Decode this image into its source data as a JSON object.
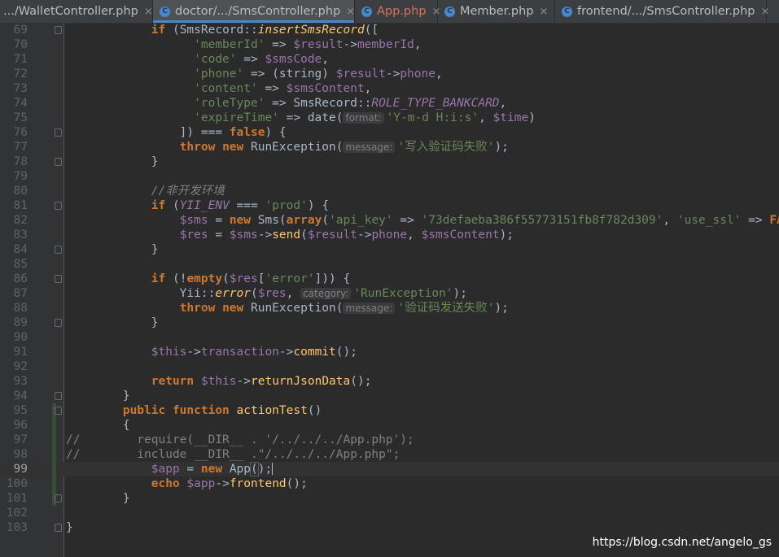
{
  "tabs": [
    {
      "label": ".../WalletController.php",
      "icon": "php-file-icon",
      "icon_glyph": "",
      "closable": true,
      "modified": false
    },
    {
      "label": "doctor/.../SmsController.php",
      "icon": "php-class-file-icon",
      "icon_glyph": "C",
      "closable": true,
      "modified": false
    },
    {
      "label": "App.php",
      "icon": "php-class-file-icon",
      "icon_glyph": "C",
      "closable": true,
      "modified": true
    },
    {
      "label": "Member.php",
      "icon": "php-class-file-icon",
      "icon_glyph": "C",
      "closable": true,
      "modified": false
    },
    {
      "label": "frontend/.../SmsController.php",
      "icon": "php-class-file-icon",
      "icon_glyph": "C",
      "closable": true,
      "modified": false
    }
  ],
  "active_tab": 1,
  "current_line": 99,
  "colors": {
    "keyword": "#cc7832",
    "variable": "#9876aa",
    "string": "#6a8759",
    "function": "#ffc66d",
    "comment": "#808080",
    "text": "#a9b7c6",
    "modified_tab": "#e06c5b"
  },
  "lines": [
    {
      "num": "69",
      "fold": true,
      "tokens": [
        [
          "p",
          "            "
        ],
        [
          "kw",
          "if"
        ],
        [
          "p",
          " (SmsRecord::"
        ],
        [
          "sfn",
          "insertSmsRecord"
        ],
        [
          "p",
          "(["
        ]
      ]
    },
    {
      "num": "70",
      "tokens": [
        [
          "p",
          "                  "
        ],
        [
          "str",
          "'memberId'"
        ],
        [
          "p",
          " => "
        ],
        [
          "var",
          "$result"
        ],
        [
          "p",
          "->"
        ],
        [
          "var",
          "memberId"
        ],
        [
          "p",
          ","
        ]
      ]
    },
    {
      "num": "71",
      "tokens": [
        [
          "p",
          "                  "
        ],
        [
          "str",
          "'code'"
        ],
        [
          "p",
          " => "
        ],
        [
          "var",
          "$smsCode"
        ],
        [
          "p",
          ","
        ]
      ]
    },
    {
      "num": "72",
      "tokens": [
        [
          "p",
          "                  "
        ],
        [
          "str",
          "'phone'"
        ],
        [
          "p",
          " => (string) "
        ],
        [
          "var",
          "$result"
        ],
        [
          "p",
          "->"
        ],
        [
          "var",
          "phone"
        ],
        [
          "p",
          ","
        ]
      ]
    },
    {
      "num": "73",
      "tokens": [
        [
          "p",
          "                  "
        ],
        [
          "str",
          "'content'"
        ],
        [
          "p",
          " => "
        ],
        [
          "var",
          "$smsContent"
        ],
        [
          "p",
          ","
        ]
      ]
    },
    {
      "num": "74",
      "tokens": [
        [
          "p",
          "                  "
        ],
        [
          "str",
          "'roleType'"
        ],
        [
          "p",
          " => SmsRecord::"
        ],
        [
          "cst",
          "ROLE_TYPE_BANKCARD"
        ],
        [
          "p",
          ","
        ]
      ]
    },
    {
      "num": "75",
      "tokens": [
        [
          "p",
          "                  "
        ],
        [
          "str",
          "'expireTime'"
        ],
        [
          "p",
          " => date("
        ],
        [
          "hint",
          "format:"
        ],
        [
          "str",
          "'Y-m-d H:i:s'"
        ],
        [
          "p",
          ", "
        ],
        [
          "var",
          "$time"
        ],
        [
          "p",
          ")"
        ]
      ]
    },
    {
      "num": "76",
      "fold": true,
      "tokens": [
        [
          "p",
          "                ]) === "
        ],
        [
          "kw",
          "false"
        ],
        [
          "p",
          ") {"
        ]
      ]
    },
    {
      "num": "77",
      "tokens": [
        [
          "p",
          "                "
        ],
        [
          "kw",
          "throw new"
        ],
        [
          "p",
          " RunException("
        ],
        [
          "hint",
          "message:"
        ],
        [
          "str",
          "'写入验证码失败'"
        ],
        [
          "p",
          ");"
        ]
      ]
    },
    {
      "num": "78",
      "fold": true,
      "tokens": [
        [
          "p",
          "            }"
        ]
      ]
    },
    {
      "num": "79",
      "tokens": []
    },
    {
      "num": "80",
      "tokens": [
        [
          "p",
          "            "
        ],
        [
          "cmti",
          "//非开发环境"
        ]
      ]
    },
    {
      "num": "81",
      "fold": true,
      "tokens": [
        [
          "p",
          "            "
        ],
        [
          "kw",
          "if"
        ],
        [
          "p",
          " ("
        ],
        [
          "cst",
          "YII_ENV"
        ],
        [
          "p",
          " === "
        ],
        [
          "str",
          "'prod'"
        ],
        [
          "p",
          ") {"
        ]
      ]
    },
    {
      "num": "82",
      "tokens": [
        [
          "p",
          "                "
        ],
        [
          "var",
          "$sms"
        ],
        [
          "p",
          " = "
        ],
        [
          "kw",
          "new"
        ],
        [
          "p",
          " Sms("
        ],
        [
          "kw",
          "array"
        ],
        [
          "p",
          "("
        ],
        [
          "str",
          "'api_key'"
        ],
        [
          "p",
          " => "
        ],
        [
          "str",
          "'73defaeba386f55773151fb8f782d309'"
        ],
        [
          "p",
          ", "
        ],
        [
          "str",
          "'use_ssl'"
        ],
        [
          "p",
          " => "
        ],
        [
          "kw",
          "FALSE"
        ]
      ]
    },
    {
      "num": "83",
      "tokens": [
        [
          "p",
          "                "
        ],
        [
          "var",
          "$res"
        ],
        [
          "p",
          " = "
        ],
        [
          "var",
          "$sms"
        ],
        [
          "p",
          "->"
        ],
        [
          "fn",
          "send"
        ],
        [
          "p",
          "("
        ],
        [
          "var",
          "$result"
        ],
        [
          "p",
          "->"
        ],
        [
          "var",
          "phone"
        ],
        [
          "p",
          ", "
        ],
        [
          "var",
          "$smsContent"
        ],
        [
          "p",
          ");"
        ]
      ]
    },
    {
      "num": "84",
      "fold": true,
      "tokens": [
        [
          "p",
          "            }"
        ]
      ]
    },
    {
      "num": "85",
      "tokens": []
    },
    {
      "num": "86",
      "fold": true,
      "tokens": [
        [
          "p",
          "            "
        ],
        [
          "kw",
          "if"
        ],
        [
          "p",
          " (!"
        ],
        [
          "kw",
          "empty"
        ],
        [
          "p",
          "("
        ],
        [
          "var",
          "$res"
        ],
        [
          "p",
          "["
        ],
        [
          "str",
          "'error'"
        ],
        [
          "p",
          "])) {"
        ]
      ]
    },
    {
      "num": "87",
      "tokens": [
        [
          "p",
          "                Yii::"
        ],
        [
          "sfn",
          "error"
        ],
        [
          "p",
          "("
        ],
        [
          "var",
          "$res"
        ],
        [
          "p",
          ", "
        ],
        [
          "hint",
          "category:"
        ],
        [
          "str",
          "'RunException'"
        ],
        [
          "p",
          ");"
        ]
      ]
    },
    {
      "num": "88",
      "tokens": [
        [
          "p",
          "                "
        ],
        [
          "kw",
          "throw new"
        ],
        [
          "p",
          " RunException("
        ],
        [
          "hint",
          "message:"
        ],
        [
          "str",
          "'验证码发送失败'"
        ],
        [
          "p",
          ");"
        ]
      ]
    },
    {
      "num": "89",
      "fold": true,
      "tokens": [
        [
          "p",
          "            }"
        ]
      ]
    },
    {
      "num": "90",
      "tokens": []
    },
    {
      "num": "91",
      "tokens": [
        [
          "p",
          "            "
        ],
        [
          "var",
          "$this"
        ],
        [
          "p",
          "->"
        ],
        [
          "var",
          "transaction"
        ],
        [
          "p",
          "->"
        ],
        [
          "fn",
          "commit"
        ],
        [
          "p",
          "();"
        ]
      ]
    },
    {
      "num": "92",
      "tokens": []
    },
    {
      "num": "93",
      "tokens": [
        [
          "p",
          "            "
        ],
        [
          "kw",
          "return"
        ],
        [
          "p",
          " "
        ],
        [
          "var",
          "$this"
        ],
        [
          "p",
          "->"
        ],
        [
          "fn",
          "returnJsonData"
        ],
        [
          "p",
          "();"
        ]
      ]
    },
    {
      "num": "94",
      "fold": true,
      "tokens": [
        [
          "p",
          "        }"
        ]
      ]
    },
    {
      "num": "95",
      "fold": true,
      "vcs": true,
      "tokens": [
        [
          "p",
          "        "
        ],
        [
          "kw",
          "public function"
        ],
        [
          "p",
          " "
        ],
        [
          "fn",
          "actionTest"
        ],
        [
          "p",
          "()"
        ]
      ]
    },
    {
      "num": "96",
      "vcs": true,
      "tokens": [
        [
          "p",
          "        {"
        ]
      ]
    },
    {
      "num": "97",
      "vcs": true,
      "tokens": [
        [
          "cmt",
          "//        require(__DIR__ . '/../../../App.php');"
        ]
      ]
    },
    {
      "num": "98",
      "vcs": true,
      "tokens": [
        [
          "cmt",
          "//        include __DIR__ .\"/../../../App.php\";"
        ]
      ]
    },
    {
      "num": "99",
      "vcs": true,
      "cur": true,
      "tokens": [
        [
          "p",
          "            "
        ],
        [
          "var",
          "$app"
        ],
        [
          "p",
          " = "
        ],
        [
          "kw",
          "new"
        ],
        [
          "p",
          " App"
        ],
        [
          "bm",
          "("
        ],
        [
          "p",
          ")"
        ],
        [
          "p",
          ";"
        ],
        [
          "caret",
          ""
        ]
      ]
    },
    {
      "num": "100",
      "vcs": true,
      "tokens": [
        [
          "p",
          "            "
        ],
        [
          "kw",
          "echo"
        ],
        [
          "p",
          " "
        ],
        [
          "var",
          "$app"
        ],
        [
          "p",
          "->"
        ],
        [
          "fn",
          "frontend"
        ],
        [
          "p",
          "();"
        ]
      ]
    },
    {
      "num": "101",
      "fold": true,
      "vcs": true,
      "tokens": [
        [
          "p",
          "        }"
        ]
      ]
    },
    {
      "num": "102",
      "tokens": []
    },
    {
      "num": "103",
      "fold": true,
      "tokens": [
        [
          "p",
          "}"
        ]
      ]
    }
  ],
  "watermark": "https://blog.csdn.net/angelo_gs"
}
